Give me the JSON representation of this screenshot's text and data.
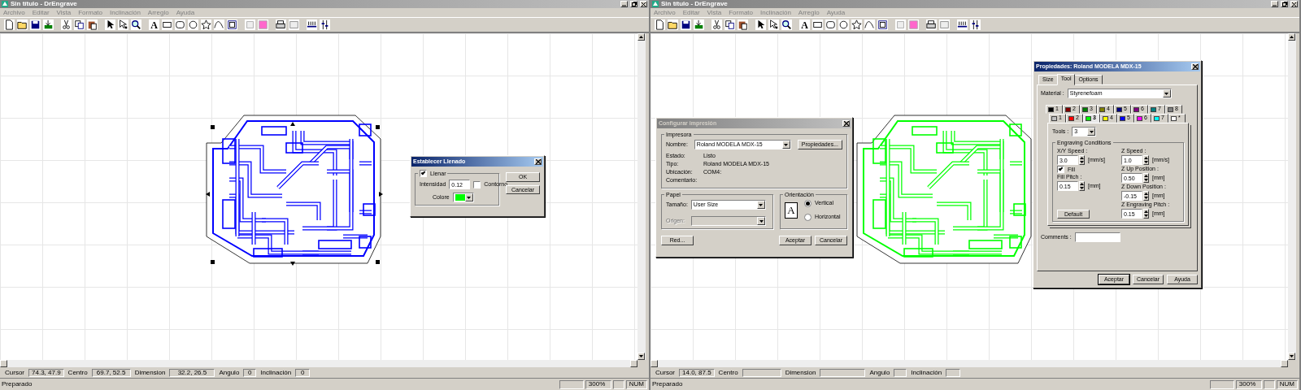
{
  "windows": [
    {
      "title": "Sin título - DrEngrave",
      "active": false,
      "menu": [
        "Archivo",
        "Editar",
        "Vista",
        "Formato",
        "Inclinación",
        "Arreglo",
        "Ayuda"
      ],
      "toolbar": {
        "text_tool": "A"
      },
      "pcb": {
        "color": "#0000ff",
        "selected": true
      },
      "status_fields": [
        {
          "label": "Cursor",
          "value": "74.3, 47.9"
        },
        {
          "label": "Centro",
          "value": "69.7, 52.5"
        },
        {
          "label": "Dimension",
          "value": "32.2, 26.5"
        },
        {
          "label": "Angulo",
          "value": "0"
        },
        {
          "label": "Inclinación",
          "value": "0"
        }
      ],
      "status_bar": {
        "text": "Preparado",
        "zoom": "300%",
        "num": "NUM"
      },
      "fill_dialog": {
        "title": "Establecer Llenado",
        "fill": {
          "label": "Llenar",
          "checked": true
        },
        "intensity": {
          "label": "Intensidad",
          "value": "0.12"
        },
        "outline": {
          "label": "Contorno",
          "checked": false
        },
        "color": {
          "label": "Colore",
          "color": "#00ff00"
        },
        "buttons": [
          "OK",
          "Cancelar"
        ]
      }
    },
    {
      "title": "Sin título - DrEngrave",
      "active": false,
      "menu": [
        "Archivo",
        "Editar",
        "Vista",
        "Formato",
        "Inclinación",
        "Arreglo",
        "Ayuda"
      ],
      "toolbar": {
        "text_tool": "A"
      },
      "pcb": {
        "color": "#00ff00",
        "selected": false
      },
      "status_fields": [
        {
          "label": "Cursor",
          "value": "14.0, 87.5"
        },
        {
          "label": "Centro"
        },
        {
          "label": "Dimension"
        },
        {
          "label": "Angulo"
        },
        {
          "label": "Inclinación"
        }
      ],
      "status_bar": {
        "text": "Preparado",
        "zoom": "300%",
        "num": "NUM"
      },
      "print_dialog": {
        "title": "Configurar impresión",
        "active": false,
        "printer_group": "Impresora",
        "name_label": "Nombre:",
        "name_value": "Roland MODELA MDX-15",
        "properties_button": "Propiedades...",
        "info": [
          {
            "label": "Estado:",
            "value": "Listo"
          },
          {
            "label": "Tipo:",
            "value": "Roland MODELA MDX-15"
          },
          {
            "label": "Ubicación:",
            "value": "COM4:"
          },
          {
            "label": "Comentario:"
          }
        ],
        "paper_group": "Papel",
        "size_label": "Tamaño:",
        "size_value": "User Size",
        "source_label": "Origen:",
        "orientation_group": "Orientación",
        "preview_letter": "A",
        "orientations": [
          {
            "label": "Vertical",
            "selected": true
          },
          {
            "label": "Horizontal",
            "selected": false
          }
        ],
        "network_button": "Red...",
        "buttons": [
          "Aceptar",
          "Cancelar"
        ]
      },
      "properties_dialog": {
        "title": "Propiedades: Roland MODELA MDX-15",
        "active": true,
        "tabs": [
          {
            "label": "Size",
            "selected": false
          },
          {
            "label": "Tool",
            "selected": true
          },
          {
            "label": "Options",
            "selected": false
          }
        ],
        "material_label": "Material :",
        "material_value": "Styrenefoam",
        "tool_tabs_back": [
          {
            "label": "1",
            "color": "#000000",
            "selected": false
          },
          {
            "label": "2",
            "color": "#800000",
            "selected": false
          },
          {
            "label": "3",
            "color": "#008000",
            "selected": false
          },
          {
            "label": "4",
            "color": "#808000",
            "selected": false
          },
          {
            "label": "5",
            "color": "#000080",
            "selected": false
          },
          {
            "label": "6",
            "color": "#800080",
            "selected": false
          },
          {
            "label": "7",
            "color": "#008080",
            "selected": false
          },
          {
            "label": "8",
            "color": "#808080",
            "selected": false
          }
        ],
        "tool_tabs_front": [
          {
            "label": "1",
            "color": "#c0c0c0",
            "selected": false
          },
          {
            "label": "2",
            "color": "#ff0000",
            "selected": false
          },
          {
            "label": "3",
            "color": "#00ff00",
            "selected": true
          },
          {
            "label": "4",
            "color": "#ffff00",
            "selected": false
          },
          {
            "label": "5",
            "color": "#0000ff",
            "selected": false
          },
          {
            "label": "6",
            "color": "#ff00ff",
            "selected": false
          },
          {
            "label": "7",
            "color": "#00ffff",
            "selected": false
          },
          {
            "label": "*",
            "color": "#ffffff",
            "selected": false
          }
        ],
        "tools_label": "Tools :",
        "tools_value": "3",
        "conditions_group": "Engraving Conditions",
        "left_fields": [
          {
            "label": "X/Y Speed :",
            "value": "3.0",
            "unit": "[mm/s]"
          },
          {
            "kind": "checkbox",
            "label": "Fill",
            "checked": true
          },
          {
            "label": "Fill Pitch :",
            "value": "0.15",
            "unit": "[mm]"
          }
        ],
        "right_fields": [
          {
            "label": "Z Speed :",
            "value": "1.0",
            "unit": "[mm/s]"
          },
          {
            "label": "Z Up Position :",
            "value": "0.50",
            "unit": "[mm]"
          },
          {
            "label": "Z Down Position :",
            "value": "-0.15",
            "unit": "[mm]"
          },
          {
            "label": "Z Engraving Pitch :",
            "value": "0.15",
            "unit": "[mm]"
          }
        ],
        "default_button": "Default",
        "comments_label": "Comments :",
        "buttons": [
          {
            "label": "Aceptar",
            "default": true
          },
          {
            "label": "Cancelar",
            "default": false
          },
          {
            "label": "Ayuda",
            "default": false
          }
        ]
      }
    }
  ]
}
